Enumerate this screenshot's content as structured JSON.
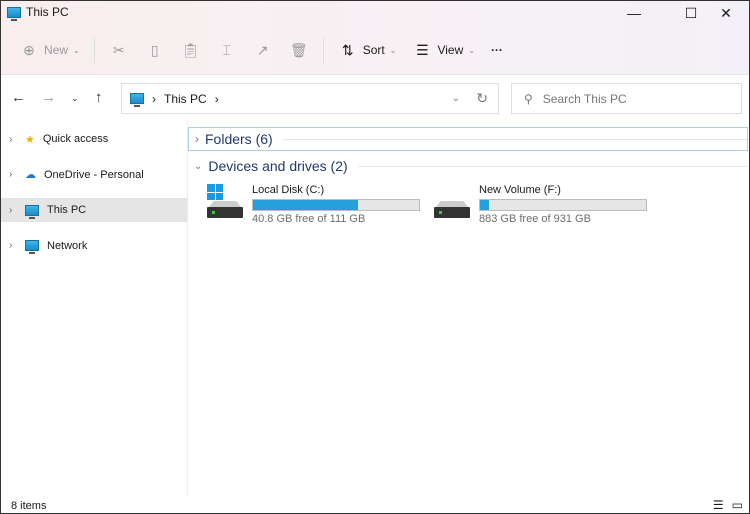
{
  "window": {
    "title": "This PC",
    "minimize": "—",
    "maximize": "☐",
    "close": "✕"
  },
  "toolbar": {
    "new": "New",
    "sort": "Sort",
    "view": "View",
    "more": "···"
  },
  "address": {
    "crumb": "This PC",
    "sep": "›",
    "search_placeholder": "Search This PC"
  },
  "sidebar": {
    "items": [
      {
        "label": "Quick access"
      },
      {
        "label": "OneDrive - Personal"
      },
      {
        "label": "This PC"
      },
      {
        "label": "Network"
      }
    ]
  },
  "groups": {
    "folders": "Folders (6)",
    "devices": "Devices and drives (2)"
  },
  "drives": [
    {
      "name": "Local Disk (C:)",
      "info": "40.8 GB free of 111 GB",
      "used_fraction": 0.632
    },
    {
      "name": "New Volume (F:)",
      "info": "883 GB free of 931 GB",
      "used_fraction": 0.052
    }
  ],
  "status": {
    "items": "8 items"
  },
  "colors": {
    "accent": "#26a0da"
  }
}
